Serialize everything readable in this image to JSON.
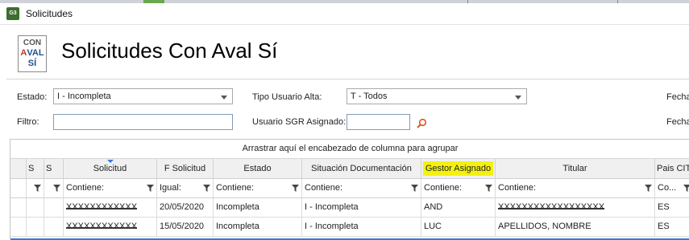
{
  "window": {
    "title": "Solicitudes",
    "app_icon": "G3"
  },
  "logo": {
    "line1": "CON",
    "line2a": "A",
    "line2b": "VAL",
    "line3": "SÍ"
  },
  "page_title": "Solicitudes Con Aval Sí",
  "filters": {
    "estado_label": "Estado:",
    "estado_value": "I - Incompleta",
    "tipo_usuario_label": "Tipo Usuario Alta:",
    "tipo_usuario_value": "T - Todos",
    "fecha1_label": "Fecha",
    "filtro_label": "Filtro:",
    "filtro_value": "",
    "usuario_sgr_label": "Usuario SGR Asignado:",
    "usuario_sgr_value": "",
    "fecha2_label": "Fecha"
  },
  "grid": {
    "group_panel_text": "Arrastrar aquí el encabezado de columna para agrupar",
    "headers": {
      "s1": "S",
      "s2": "S",
      "solicitud": "Solicitud",
      "f_solicitud": "F Solicitud",
      "estado": "Estado",
      "situacion": "Situación Documentación",
      "gestor": "Gestor Asignado",
      "titular": "Titular",
      "pais": "Pais CIT"
    },
    "filter_row": {
      "solicitud": "Contiene:",
      "f_solicitud": "Igual:",
      "estado": "Contiene:",
      "situacion": "Contiene:",
      "gestor": "Contiene:",
      "titular": "Contiene:",
      "pais": "Co..."
    },
    "rows": [
      {
        "solicitud": "XXXXXXXXXXXX",
        "f_solicitud": "20/05/2020",
        "estado": "Incompleta",
        "situacion": "I - Incompleta",
        "gestor": "AND",
        "titular": "XXXXXXXXXXXXXXXXXX",
        "pais": "ES"
      },
      {
        "solicitud": "XXXXXXXXXXXX",
        "f_solicitud": "15/05/2020",
        "estado": "Incompleta",
        "situacion": "I - Incompleta",
        "gestor": "LUC",
        "titular": "APELLIDOS, NOMBRE",
        "pais": "ES"
      }
    ]
  },
  "colors": {
    "highlight": "#f4f112",
    "accent": "#3a7bd5",
    "search_icon": "#d9541e"
  }
}
